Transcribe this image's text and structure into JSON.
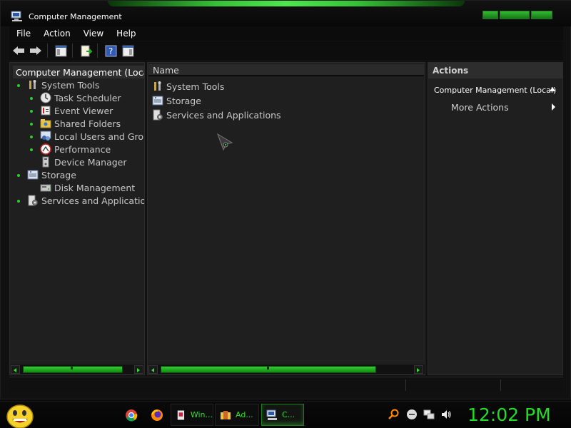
{
  "window": {
    "title": "Computer Management",
    "menu": [
      "File",
      "Action",
      "View",
      "Help"
    ]
  },
  "tree": {
    "root": "Computer Management (Local)",
    "items": [
      {
        "label": "System Tools",
        "icon": "tools-icon"
      },
      {
        "label": "Task Scheduler",
        "icon": "clock-icon"
      },
      {
        "label": "Event Viewer",
        "icon": "event-viewer-icon"
      },
      {
        "label": "Shared Folders",
        "icon": "shared-folder-icon"
      },
      {
        "label": "Local Users and Groups",
        "icon": "users-icon"
      },
      {
        "label": "Performance",
        "icon": "performance-icon"
      },
      {
        "label": "Device Manager",
        "icon": "device-manager-icon"
      },
      {
        "label": "Storage",
        "icon": "storage-icon"
      },
      {
        "label": "Disk Management",
        "icon": "disk-icon"
      },
      {
        "label": "Services and Applications",
        "icon": "services-icon"
      }
    ]
  },
  "list": {
    "column_header": "Name",
    "rows": [
      {
        "label": "System Tools"
      },
      {
        "label": "Storage"
      },
      {
        "label": "Services and Applications"
      }
    ]
  },
  "actions": {
    "header": "Actions",
    "section": "Computer Management (Local)",
    "more": "More Actions"
  },
  "taskbar": {
    "tasks": [
      "Win...",
      "Ad...",
      "C..."
    ],
    "clock": "12:02 PM"
  },
  "colors": {
    "accent": "#33dd33",
    "background": "#1f1f1f"
  }
}
